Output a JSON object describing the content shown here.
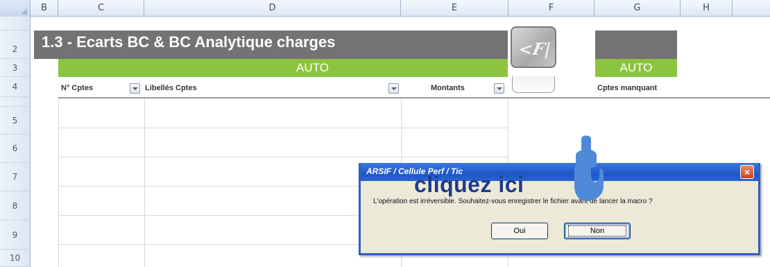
{
  "columns": [
    "B",
    "C",
    "D",
    "E",
    "F",
    "G",
    "H"
  ],
  "rows": [
    "2",
    "3",
    "4",
    "5",
    "6",
    "7",
    "8",
    "9",
    "10"
  ],
  "sheet": {
    "title": "1.3 - Ecarts BC & BC Analytique charges",
    "auto_label": "AUTO",
    "auto_label_g": "AUTO",
    "headers": {
      "comptes": "N° Cptes",
      "libelles": "Libellés Cptes",
      "montants": "Montants",
      "manquant": "Cptes manquant"
    }
  },
  "dialog": {
    "title": "ARSIF / Cellule Perf / Tic",
    "message": "L'opération est irréversible. Souhaitez-vous enregistrer le fichier avant de lancer la macro ?",
    "yes_label": "Oui",
    "no_label": "Non",
    "close_glyph": "×"
  },
  "annotation": {
    "text": "cliquez ici",
    "pointer_color": "#4f8ad8"
  },
  "colors": {
    "title_bar": "#737373",
    "green_bar": "#8bc43f",
    "dialog_titlebar": "#2a63d2"
  },
  "icons": {
    "logo": "arsif-logo-icon",
    "pointer": "pointing-hand-icon"
  }
}
